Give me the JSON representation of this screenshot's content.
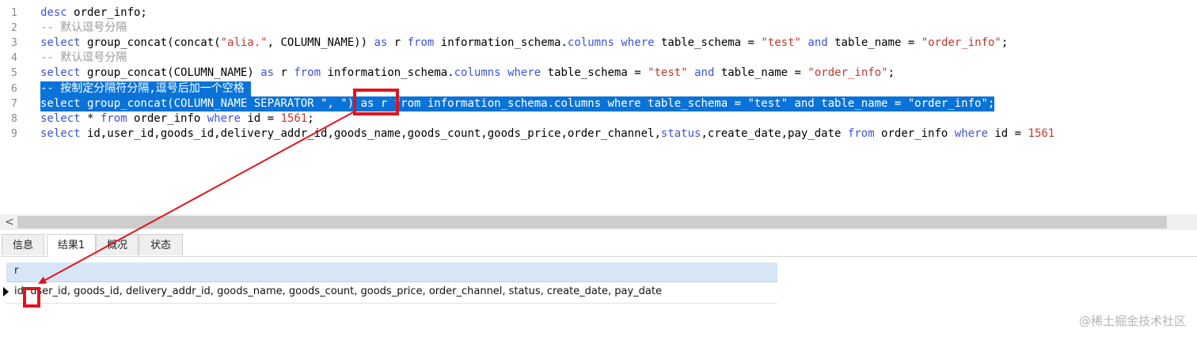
{
  "editor": {
    "lines": [
      {
        "num": "1",
        "tokens": [
          {
            "t": "desc",
            "c": "kw"
          },
          {
            "t": " order_info;",
            "c": "pl"
          }
        ]
      },
      {
        "num": "2",
        "tokens": [
          {
            "t": "-- 默认逗号分隔",
            "c": "cm"
          }
        ]
      },
      {
        "num": "3",
        "tokens": [
          {
            "t": "select",
            "c": "kw"
          },
          {
            "t": " group_concat(concat(",
            "c": "pl"
          },
          {
            "t": "\"alia.\"",
            "c": "str"
          },
          {
            "t": ", COLUMN_NAME)) ",
            "c": "pl"
          },
          {
            "t": "as",
            "c": "kw"
          },
          {
            "t": " r ",
            "c": "pl"
          },
          {
            "t": "from",
            "c": "kw"
          },
          {
            "t": " information_schema.",
            "c": "pl"
          },
          {
            "t": "columns",
            "c": "kw"
          },
          {
            "t": " ",
            "c": "pl"
          },
          {
            "t": "where",
            "c": "kw"
          },
          {
            "t": " table_schema = ",
            "c": "pl"
          },
          {
            "t": "\"test\"",
            "c": "str"
          },
          {
            "t": " ",
            "c": "pl"
          },
          {
            "t": "and",
            "c": "kw"
          },
          {
            "t": " table_name = ",
            "c": "pl"
          },
          {
            "t": "\"order_info\"",
            "c": "str"
          },
          {
            "t": ";",
            "c": "pl"
          }
        ]
      },
      {
        "num": "4",
        "tokens": [
          {
            "t": "-- 默认逗号分隔",
            "c": "cm"
          }
        ]
      },
      {
        "num": "5",
        "tokens": [
          {
            "t": "select",
            "c": "kw"
          },
          {
            "t": " group_concat(COLUMN_NAME) ",
            "c": "pl"
          },
          {
            "t": "as",
            "c": "kw"
          },
          {
            "t": " r ",
            "c": "pl"
          },
          {
            "t": "from",
            "c": "kw"
          },
          {
            "t": " information_schema.",
            "c": "pl"
          },
          {
            "t": "columns",
            "c": "kw"
          },
          {
            "t": " ",
            "c": "pl"
          },
          {
            "t": "where",
            "c": "kw"
          },
          {
            "t": " table_schema = ",
            "c": "pl"
          },
          {
            "t": "\"test\"",
            "c": "str"
          },
          {
            "t": " ",
            "c": "pl"
          },
          {
            "t": "and",
            "c": "kw"
          },
          {
            "t": " table_name = ",
            "c": "pl"
          },
          {
            "t": "\"order_info\"",
            "c": "str"
          },
          {
            "t": ";",
            "c": "pl"
          }
        ]
      },
      {
        "num": "6",
        "selected": true,
        "tokens": [
          {
            "t": "-- 按制定分隔符分隔,逗号后加一个空格 ",
            "c": "cm"
          }
        ]
      },
      {
        "num": "7",
        "selected": true,
        "tokens": [
          {
            "t": "select group_concat(COLUMN_NAME SEPARATOR \", \") as r from information_schema.columns where table_schema = \"test\" and table_name = \"order_info\";",
            "c": "pl"
          }
        ]
      },
      {
        "num": "8",
        "tokens": [
          {
            "t": "select",
            "c": "kw"
          },
          {
            "t": " * ",
            "c": "pl"
          },
          {
            "t": "from",
            "c": "kw"
          },
          {
            "t": " order_info ",
            "c": "pl"
          },
          {
            "t": "where",
            "c": "kw"
          },
          {
            "t": " id = ",
            "c": "pl"
          },
          {
            "t": "1561",
            "c": "str"
          },
          {
            "t": ";",
            "c": "pl"
          }
        ]
      },
      {
        "num": "9",
        "tokens": [
          {
            "t": "select",
            "c": "kw"
          },
          {
            "t": " id,user_id,goods_id,delivery_addr_id,goods_name,goods_count,goods_price,order_channel,",
            "c": "pl"
          },
          {
            "t": "status",
            "c": "kw"
          },
          {
            "t": ",create_date,pay_date ",
            "c": "pl"
          },
          {
            "t": "from",
            "c": "kw"
          },
          {
            "t": " order_info ",
            "c": "pl"
          },
          {
            "t": "where",
            "c": "kw"
          },
          {
            "t": " id = ",
            "c": "pl"
          },
          {
            "t": "1561",
            "c": "str"
          }
        ]
      }
    ]
  },
  "scrollbar": {
    "left_arrow": "<"
  },
  "tabs": [
    {
      "label": "信息",
      "active": false
    },
    {
      "label": "结果1",
      "active": true
    },
    {
      "label": "概况",
      "active": false
    },
    {
      "label": "状态",
      "active": false
    }
  ],
  "result": {
    "column_header": "r",
    "row_value": "id, user_id, goods_id, delivery_addr_id, goods_name, goods_count, goods_price, order_channel, status, create_date, pay_date"
  },
  "watermark": "@稀土掘金技术社区",
  "colors": {
    "annotation": "#e0141e",
    "selection": "#0a73d9",
    "keyword": "#3c55d8",
    "string": "#c0392b"
  }
}
